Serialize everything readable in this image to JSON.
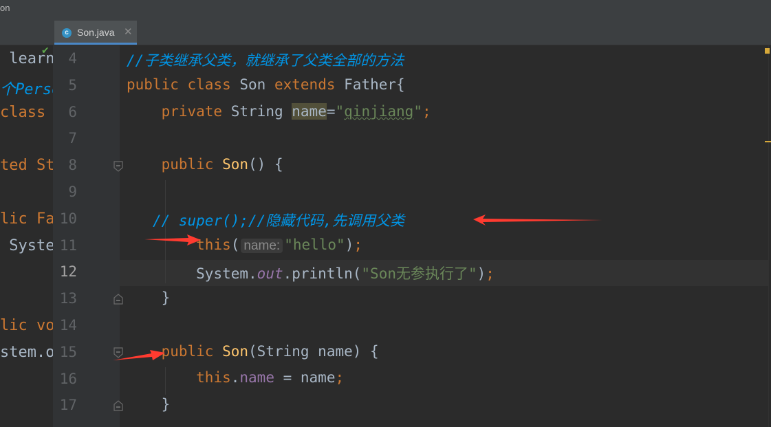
{
  "window": {
    "title_fragment": "on"
  },
  "tab": {
    "label": "Son.java",
    "icon": "c-class-icon",
    "close": "✕"
  },
  "left_pane_lines": [
    {
      "text": " learn",
      "color": "#a9b7c6"
    },
    {
      "text": "个Perso",
      "color": "#0095e6"
    },
    {
      "text": "class",
      "color": "#cc7832"
    },
    {
      "text": "",
      "color": "#a9b7c6"
    },
    {
      "text": "ted St",
      "color": "#cc7832"
    },
    {
      "text": "",
      "color": "#a9b7c6"
    },
    {
      "text": "lic Fa",
      "color": "#cc7832"
    },
    {
      "text": " Syste",
      "color": "#a9b7c6"
    },
    {
      "text": "",
      "color": "#a9b7c6"
    },
    {
      "text": "",
      "color": "#a9b7c6"
    },
    {
      "text": "lic vo",
      "color": "#cc7832"
    },
    {
      "text": "stem.o",
      "color": "#a9b7c6"
    }
  ],
  "line_numbers": [
    "4",
    "5",
    "6",
    "7",
    "8",
    "9",
    "10",
    "11",
    "12",
    "13",
    "14",
    "15",
    "16",
    "17"
  ],
  "active_line": "12",
  "code": {
    "l4_comment": "//子类继承父类，就继承了父类全部的方法",
    "l5_public": "public",
    "l5_class": "class",
    "l5_name": "Son",
    "l5_extends": "extends",
    "l5_parent": "Father{",
    "l6_private": "private",
    "l6_type": "String",
    "l6_field": "name",
    "l6_eq": "=",
    "l6_q1": "\"",
    "l6_val": "qinjiang",
    "l6_q2": "\"",
    "l6_semi": ";",
    "l8_public": "public",
    "l8_ctor": "Son",
    "l8_rest": "() {",
    "l10_comment": "// super();//隐藏代码,先调用父类",
    "l11_this": "this",
    "l11_open": "(",
    "l11_hint": "name:",
    "l11_str": "\"hello\"",
    "l11_close": ")",
    "l11_semi": ";",
    "l12_system": "System.",
    "l12_out": "out",
    "l12_println": ".println(",
    "l12_str": "\"Son无参执行了\"",
    "l12_close": ")",
    "l12_semi": ";",
    "l13_brace": "}",
    "l15_public": "public",
    "l15_ctor": "Son",
    "l15_rest": "(String name) {",
    "l16_this": "this",
    "l16_dot": ".",
    "l16_field": "name",
    "l16_rest": " = name",
    "l16_semi": ";",
    "l17_brace": "}"
  },
  "colors": {
    "background": "#2b2b2b",
    "keyword": "#cc7832",
    "string": "#6a8759",
    "comment": "#0095e6",
    "method": "#ffc66d",
    "field": "#9876aa",
    "text": "#a9b7c6",
    "annotation_arrow": "#ff3b30"
  }
}
